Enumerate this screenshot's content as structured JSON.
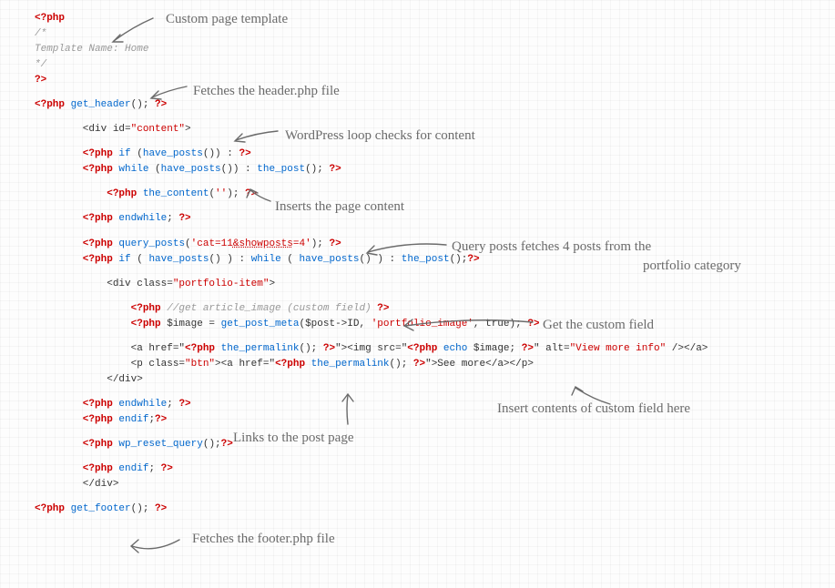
{
  "code": {
    "l01_open": "<?php",
    "l02": "/*",
    "l03": "Template Name: Home",
    "l04": "*/",
    "l05_close": "?>",
    "l06_open": "<?php",
    "l06_func": " get_header",
    "l06_rest": "(); ",
    "l06_close": "?>",
    "l07": "        <div id=",
    "l07_str": "\"content\"",
    "l07_end": ">",
    "l08_open": "        <?php",
    "l08_kw": " if",
    "l08_mid": " (",
    "l08_func": "have_posts",
    "l08_end": "()) : ",
    "l08_close": "?>",
    "l09_open": "        <?php",
    "l09_kw": " while",
    "l09_mid": " (",
    "l09_func": "have_posts",
    "l09_end": "()) : ",
    "l09_func2": "the_post",
    "l09_end2": "(); ",
    "l09_close": "?>",
    "l10_open": "            <?php",
    "l10_func": " the_content",
    "l10_mid": "(",
    "l10_str": "''",
    "l10_end": "); ",
    "l10_close": "?>",
    "l11_open": "        <?php",
    "l11_kw": " endwhile",
    "l11_end": "; ",
    "l11_close": "?>",
    "l12_open": "        <?php",
    "l12_func": " query_posts",
    "l12_mid": "(",
    "l12_str1": "'cat=11",
    "l12_str2": "&showposts",
    "l12_str3": "=4'",
    "l12_end": "); ",
    "l12_close": "?>",
    "l13_open": "        <?php",
    "l13_kw": " if",
    "l13_mid": " ( ",
    "l13_func": "have_posts",
    "l13_mid2": "() ) : ",
    "l13_kw2": "while",
    "l13_mid3": " ( ",
    "l13_func2": "have_posts",
    "l13_end": "() ) : ",
    "l13_func3": "the_post",
    "l13_end2": "();",
    "l13_close": "?>",
    "l14_mid": "            <div class=",
    "l14_str": "\"portfolio-item\"",
    "l14_end": ">",
    "l15_open": "                <?php",
    "l15_comment": " //get article_image (custom field) ",
    "l15_close": "?>",
    "l16_open": "                <?php",
    "l16_var": " $image = ",
    "l16_func": "get_post_meta",
    "l16_mid": "($post->ID, ",
    "l16_str": "'portfolio_image'",
    "l16_end": ", true); ",
    "l16_close": "?>",
    "l17_pre": "                <a href=\"",
    "l17_open": "<?php",
    "l17_func": " the_permalink",
    "l17_mid": "(); ",
    "l17_close": "?>",
    "l17_mid2": "\"><img src=\"",
    "l17_open2": "<?php",
    "l17_kw": " echo",
    "l17_var": " $image; ",
    "l17_close2": "?>",
    "l17_mid3": "\" alt=",
    "l17_str": "\"View more info\"",
    "l17_end": " /></a>",
    "l18_pre": "                <p class=",
    "l18_str": "\"btn\"",
    "l18_mid": "><a href=\"",
    "l18_open": "<?php",
    "l18_func": " the_permalink",
    "l18_mid2": "(); ",
    "l18_close": "?>",
    "l18_end": "\">See more</a></p>",
    "l19": "            </div>",
    "l20_open": "        <?php",
    "l20_kw": " endwhile",
    "l20_end": "; ",
    "l20_close": "?>",
    "l21_open": "        <?php",
    "l21_kw": " endif",
    "l21_end": ";",
    "l21_close": "?>",
    "l22_open": "        <?php",
    "l22_func": " wp_reset_query",
    "l22_end": "();",
    "l22_close": "?>",
    "l23_open": "        <?php",
    "l23_kw": " endif",
    "l23_end": "; ",
    "l23_close": "?>",
    "l24": "        </div>",
    "l25_open": "<?php",
    "l25_func": " get_footer",
    "l25_end": "(); ",
    "l25_close": "?>"
  },
  "annotations": {
    "a1": "Custom page template",
    "a2": "Fetches the header.php file",
    "a3": "WordPress loop checks for content",
    "a4": "Inserts the page content",
    "a5a": "Query posts fetches 4 posts from the",
    "a5b": "portfolio category",
    "a6": "Get the custom field",
    "a7": "Insert contents of custom field here",
    "a8": "Links to the post page",
    "a9": "Fetches the footer.php file"
  }
}
